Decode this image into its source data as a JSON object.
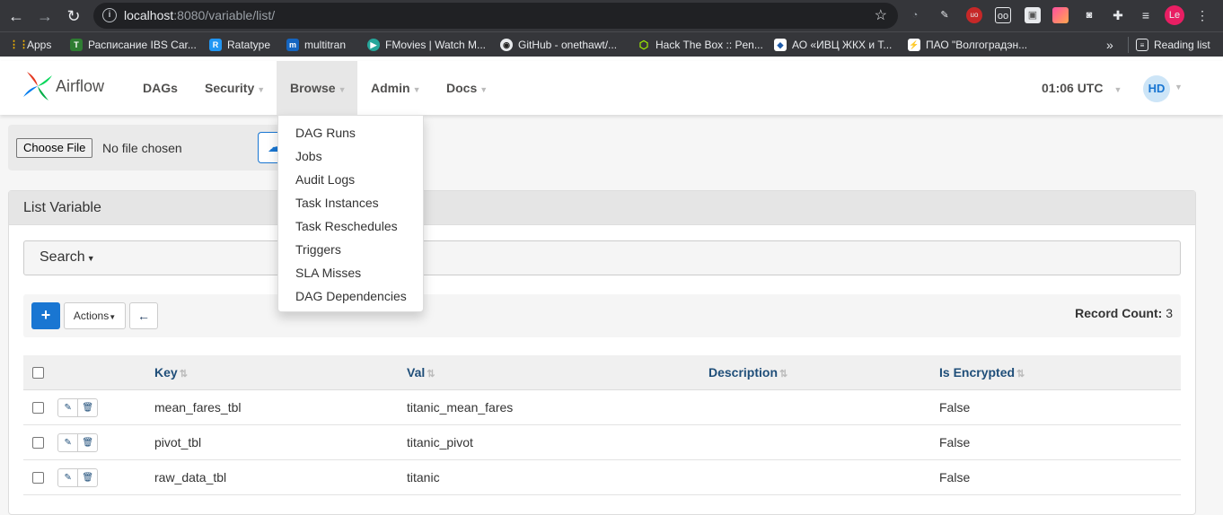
{
  "browser": {
    "url_host": "localhost",
    "url_path": ":8080/variable/list/",
    "profile_initials": "Le",
    "bookmarks": [
      {
        "label": "Apps",
        "color": "#f4b400",
        "glyph": "⋮⋮"
      },
      {
        "label": "Расписание IBS Car...",
        "color": "#2e7d32",
        "glyph": "T"
      },
      {
        "label": "Ratatype",
        "color": "#2196f3",
        "glyph": "R"
      },
      {
        "label": "multitran",
        "color": "#1565c0",
        "glyph": "m"
      },
      {
        "label": "FMovies | Watch M...",
        "color": "#26a69a",
        "glyph": "▶"
      },
      {
        "label": "GitHub - onethawt/...",
        "color": "#e8eaed",
        "glyph": "◉"
      },
      {
        "label": "Hack The Box :: Pen...",
        "color": "#9fef00",
        "glyph": "⬡"
      },
      {
        "label": "АО «ИВЦ ЖКХ и Т...",
        "color": "#1e5aa8",
        "glyph": "◆"
      },
      {
        "label": "ПАО \"Волгоградэн...",
        "color": "#1565c0",
        "glyph": "⚡"
      }
    ],
    "more_bookmarks": "»",
    "reading_list": "Reading list"
  },
  "airflow": {
    "brand": "Airflow",
    "menu": [
      {
        "label": "DAGs",
        "has_caret": false
      },
      {
        "label": "Security",
        "has_caret": true
      },
      {
        "label": "Browse",
        "has_caret": true
      },
      {
        "label": "Admin",
        "has_caret": true
      },
      {
        "label": "Docs",
        "has_caret": true
      }
    ],
    "time": "01:06 UTC",
    "user_initials": "HD",
    "browse_dropdown": [
      "DAG Runs",
      "Jobs",
      "Audit Logs",
      "Task Instances",
      "Task Reschedules",
      "Triggers",
      "SLA Misses",
      "DAG Dependencies"
    ]
  },
  "upload": {
    "choose_file": "Choose File",
    "no_file": "No file chosen"
  },
  "panel": {
    "title": "List Variable",
    "search_label": "Search",
    "add_label": "+",
    "actions_label": "Actions",
    "record_count_label": "Record Count:",
    "record_count": "3",
    "columns": [
      "Key",
      "Val",
      "Description",
      "Is Encrypted"
    ],
    "rows": [
      {
        "key": "mean_fares_tbl",
        "val": "titanic_mean_fares",
        "description": "",
        "is_encrypted": "False"
      },
      {
        "key": "pivot_tbl",
        "val": "titanic_pivot",
        "description": "",
        "is_encrypted": "False"
      },
      {
        "key": "raw_data_tbl",
        "val": "titanic",
        "description": "",
        "is_encrypted": "False"
      }
    ]
  }
}
